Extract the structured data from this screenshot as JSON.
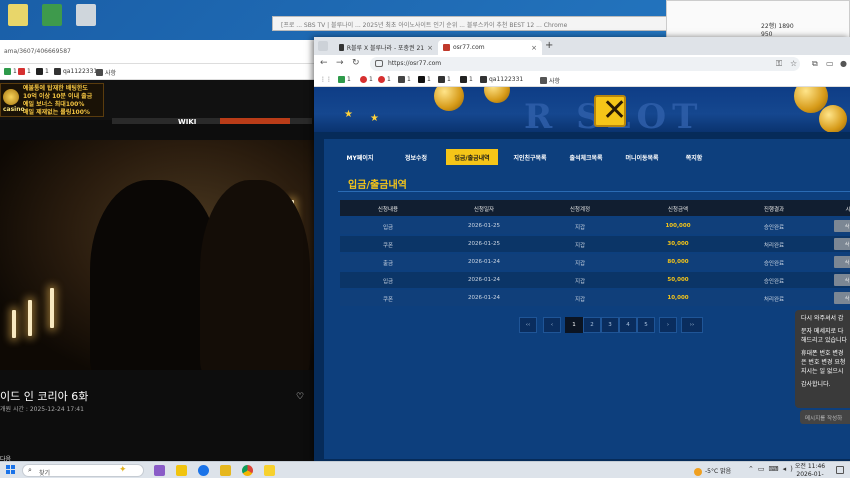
{
  "desktop": {
    "icons": [
      "file-icon",
      "excel-icon",
      "recycle-bin-icon"
    ]
  },
  "background_windows": {
    "title_text": "[프로 ... SBS TV | 블루나이 ... 2025년 최초 아이노사이트 인기 순위 ... 블루스카이 추천 BEST 12 ... Chrome",
    "right_line_1": "22행) 1890",
    "right_line_2": "950"
  },
  "left_browser": {
    "url": "ama/3607/406669587",
    "bookmarks": [
      "1",
      "1",
      "1",
      "qa1122331",
      "사항"
    ],
    "ad": {
      "lines": [
        "예불통에 탑재한 배팅한도",
        "10억 이상 10분 이내 출금",
        "예일 보너스 최대100%",
        "매일 제재없는 롤링100%"
      ],
      "brand": "casino"
    },
    "wiki_label": "WIKI",
    "video_title": "이드 인 코리아 6화",
    "video_meta": "개원 시간 : 2025-12-24 17:41",
    "bottom_text": "다음"
  },
  "main_browser": {
    "tabs": [
      {
        "label": "R블루 X 블루나라 - 포충권 21"
      },
      {
        "label": "osr77.com"
      }
    ],
    "url": "https://osr77.com",
    "bookmarks": [
      "1",
      "1",
      "1",
      "1",
      "1",
      "1",
      "1",
      "qa1122331",
      "사항"
    ],
    "site": {
      "logo_text": "R SLOT",
      "menu": [
        {
          "label": "MY페이지",
          "active": false
        },
        {
          "label": "정보수정",
          "active": false
        },
        {
          "label": "입금/출금내역",
          "active": true
        },
        {
          "label": "지인친구목록",
          "active": false
        },
        {
          "label": "출석체크목록",
          "active": false
        },
        {
          "label": "머니이동목록",
          "active": false
        },
        {
          "label": "쪽지함",
          "active": false
        }
      ],
      "section_title": "입금/출금내역",
      "table": {
        "headers": [
          "신청내용",
          "신청일자",
          "신청계정",
          "신청금액",
          "진행결과",
          "시"
        ],
        "rows": [
          {
            "type": "입금",
            "date": "2026-01-25",
            "account": "지갑",
            "amount": "100,000",
            "status": "승인완료",
            "btn": "삭"
          },
          {
            "type": "쿠폰",
            "date": "2026-01-25",
            "account": "지갑",
            "amount": "30,000",
            "status": "처리완료",
            "btn": "삭"
          },
          {
            "type": "출금",
            "date": "2026-01-24",
            "account": "지갑",
            "amount": "80,000",
            "status": "승인완료",
            "btn": "삭"
          },
          {
            "type": "입금",
            "date": "2026-01-24",
            "account": "지갑",
            "amount": "50,000",
            "status": "승인완료",
            "btn": "삭"
          },
          {
            "type": "쿠폰",
            "date": "2026-01-24",
            "account": "지갑",
            "amount": "10,000",
            "status": "처리완료",
            "btn": "삭"
          }
        ]
      },
      "pagination": [
        "‹‹",
        "‹",
        "1",
        "2",
        "3",
        "4",
        "5",
        "›",
        "››"
      ],
      "current_page": "1"
    }
  },
  "chat": {
    "lines": [
      "다시 와주셔서 감",
      "",
      "문자 메세지로 다",
      "해드리고 있습니다",
      "",
      "휴대폰 번호 변경",
      "은 번호 변경 요청",
      "지시는 일 없으시",
      "",
      "감사합니다."
    ],
    "input_placeholder": "메시지를 작성하"
  },
  "taskbar": {
    "search_placeholder": "찾기",
    "weather": "-5°C 맑음",
    "time": "오전 11:46",
    "date": "2026-01-25"
  }
}
